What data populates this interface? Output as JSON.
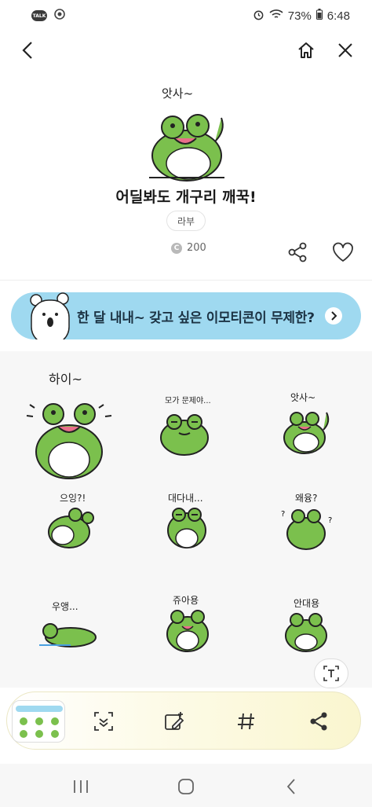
{
  "status": {
    "battery": "73%",
    "time": "6:48",
    "talk_badge": "TALK"
  },
  "nav": {
    "back": "back-icon",
    "home": "home-icon",
    "close": "close-icon"
  },
  "hero": {
    "art_caption": "앗사~"
  },
  "title": "어딜봐도 개구리 깨꾹!",
  "author": "라부",
  "price": {
    "coin": "C",
    "amount": "200"
  },
  "banner": {
    "text": "한 달 내내~ 갖고 싶은 이모티콘이 무제한?"
  },
  "stickers": [
    {
      "caption": "하이~"
    },
    {
      "caption": "모가 문제야..."
    },
    {
      "caption": "앗사~"
    },
    {
      "caption": "으잉?!"
    },
    {
      "caption": "대다내..."
    },
    {
      "caption": "왜융?"
    },
    {
      "caption": "우앵..."
    },
    {
      "caption": "쥬아용"
    },
    {
      "caption": "안대용"
    }
  ],
  "toolbar": {
    "tools": [
      "scan-icon",
      "edit-icon",
      "hashtag-icon",
      "share-icon"
    ]
  },
  "colors": {
    "frog": "#7bc04d",
    "banner": "#9fd9f0",
    "accent": "#f3e23c"
  }
}
